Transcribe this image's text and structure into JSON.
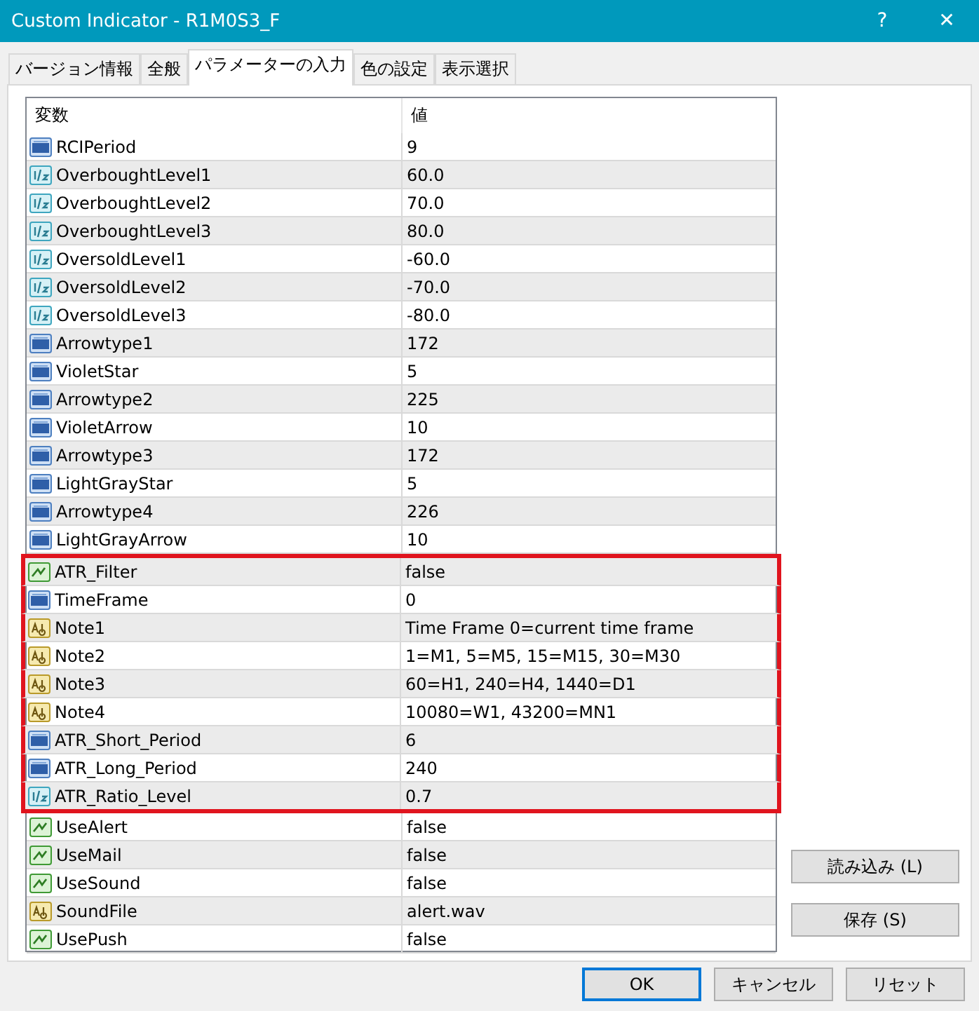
{
  "window": {
    "title": "Custom Indicator - R1M0S3_F",
    "help": "?",
    "close": "✕"
  },
  "tabs": [
    {
      "label": "バージョン情報",
      "selected": false
    },
    {
      "label": "全般",
      "selected": false
    },
    {
      "label": "パラメーターの入力",
      "selected": true
    },
    {
      "label": "色の設定",
      "selected": false
    },
    {
      "label": "表示選択",
      "selected": false
    }
  ],
  "table": {
    "columns": [
      "変数",
      "値"
    ],
    "rows": [
      {
        "kind": "int",
        "name": "RCIPeriod",
        "value": "9",
        "highlighted": false
      },
      {
        "kind": "double",
        "name": "OverboughtLevel1",
        "value": "60.0",
        "highlighted": false
      },
      {
        "kind": "double",
        "name": "OverboughtLevel2",
        "value": "70.0",
        "highlighted": false
      },
      {
        "kind": "double",
        "name": "OverboughtLevel3",
        "value": "80.0",
        "highlighted": false
      },
      {
        "kind": "double",
        "name": "OversoldLevel1",
        "value": "-60.0",
        "highlighted": false
      },
      {
        "kind": "double",
        "name": "OversoldLevel2",
        "value": "-70.0",
        "highlighted": false
      },
      {
        "kind": "double",
        "name": "OversoldLevel3",
        "value": "-80.0",
        "highlighted": false
      },
      {
        "kind": "int",
        "name": "Arrowtype1",
        "value": "172",
        "highlighted": false
      },
      {
        "kind": "int",
        "name": "VioletStar",
        "value": "5",
        "highlighted": false
      },
      {
        "kind": "int",
        "name": "Arrowtype2",
        "value": "225",
        "highlighted": false
      },
      {
        "kind": "int",
        "name": "VioletArrow",
        "value": "10",
        "highlighted": false
      },
      {
        "kind": "int",
        "name": "Arrowtype3",
        "value": "172",
        "highlighted": false
      },
      {
        "kind": "int",
        "name": "LightGrayStar",
        "value": "5",
        "highlighted": false
      },
      {
        "kind": "int",
        "name": "Arrowtype4",
        "value": "226",
        "highlighted": false
      },
      {
        "kind": "int",
        "name": "LightGrayArrow",
        "value": "10",
        "highlighted": false
      },
      {
        "kind": "bool",
        "name": "ATR_Filter",
        "value": "false",
        "highlighted": true
      },
      {
        "kind": "int",
        "name": "TimeFrame",
        "value": "0",
        "highlighted": true
      },
      {
        "kind": "string",
        "name": "Note1",
        "value": "Time Frame 0=current time frame",
        "highlighted": true
      },
      {
        "kind": "string",
        "name": "Note2",
        "value": "1=M1, 5=M5, 15=M15, 30=M30",
        "highlighted": true
      },
      {
        "kind": "string",
        "name": "Note3",
        "value": "60=H1, 240=H4, 1440=D1",
        "highlighted": true
      },
      {
        "kind": "string",
        "name": "Note4",
        "value": "10080=W1, 43200=MN1",
        "highlighted": true
      },
      {
        "kind": "int",
        "name": "ATR_Short_Period",
        "value": "6",
        "highlighted": true
      },
      {
        "kind": "int",
        "name": "ATR_Long_Period",
        "value": "240",
        "highlighted": true
      },
      {
        "kind": "double",
        "name": "ATR_Ratio_Level",
        "value": "0.7",
        "highlighted": true
      },
      {
        "kind": "bool",
        "name": "UseAlert",
        "value": "false",
        "highlighted": false
      },
      {
        "kind": "bool",
        "name": "UseMail",
        "value": "false",
        "highlighted": false
      },
      {
        "kind": "bool",
        "name": "UseSound",
        "value": "false",
        "highlighted": false
      },
      {
        "kind": "string",
        "name": "SoundFile",
        "value": "alert.wav",
        "highlighted": false
      },
      {
        "kind": "bool",
        "name": "UsePush",
        "value": "false",
        "highlighted": false
      }
    ]
  },
  "side_buttons": [
    "読み込み (L)",
    "保存 (S)"
  ],
  "buttons": [
    {
      "label": "OK",
      "focused": true
    },
    {
      "label": "キャンセル",
      "focused": false
    },
    {
      "label": "リセット",
      "focused": false
    }
  ]
}
